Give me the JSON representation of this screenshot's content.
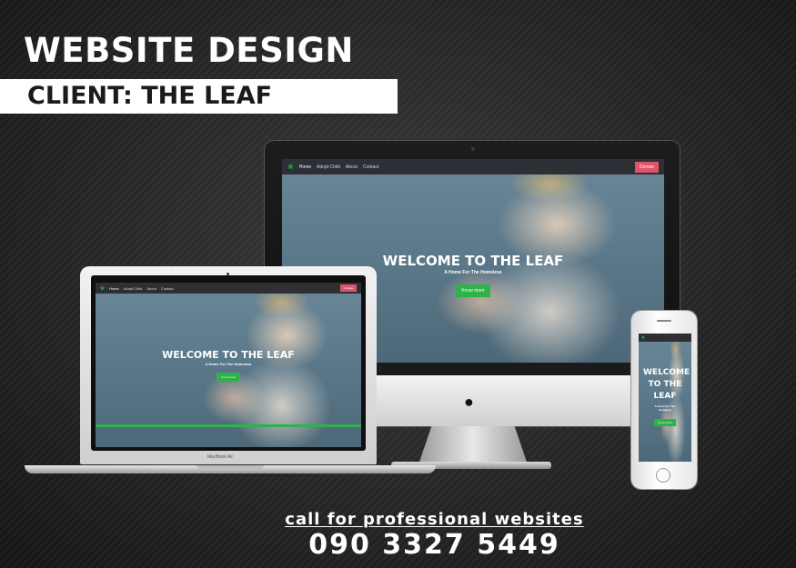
{
  "headline": "WEBSITE DESIGN",
  "client_label": "CLIENT: THE LEAF",
  "website": {
    "logo_icon": "leaf-icon",
    "nav_links": [
      "Home",
      "Adopt Child",
      "About",
      "Contact"
    ],
    "donate_label": "Donate",
    "hero_title": "WELCOME TO THE LEAF",
    "hero_subtitle": "A Home For The Homeless",
    "cta_button": "Know more"
  },
  "laptop_label": "MacBook Air",
  "cta": {
    "label": "call for professional websites",
    "phone": "090 3327 5449"
  },
  "colors": {
    "accent_green": "#2db34a",
    "donate_red": "#e0536a",
    "background": "#262626"
  }
}
